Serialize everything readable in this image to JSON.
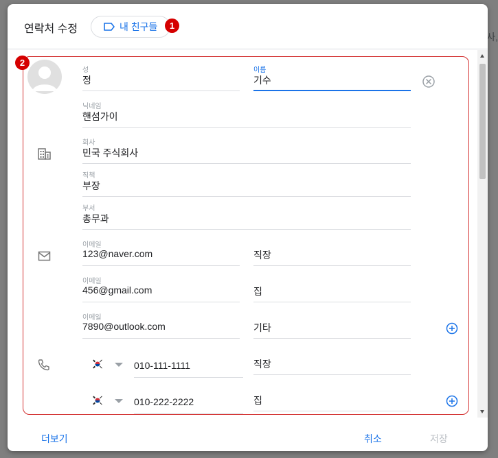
{
  "background": {
    "fragment_text": "사,"
  },
  "header": {
    "title": "연락처 수정",
    "label_chip": "내 친구들",
    "badge_1": "1"
  },
  "body": {
    "badge_2": "2",
    "name": {
      "last_label": "성",
      "last_value": "정",
      "first_label": "이름",
      "first_value": "기수"
    },
    "nickname": {
      "label": "닉네임",
      "value": "핸섬가이"
    },
    "company": {
      "label": "회사",
      "value": "민국 주식회사"
    },
    "job_title": {
      "label": "직책",
      "value": "부장"
    },
    "department": {
      "label": "부서",
      "value": "총무과"
    },
    "emails": [
      {
        "label": "이메일",
        "value": "123@naver.com",
        "type": "직장"
      },
      {
        "label": "이메일",
        "value": "456@gmail.com",
        "type": "집"
      },
      {
        "label": "이메일",
        "value": "7890@outlook.com",
        "type": "기타"
      }
    ],
    "phones": [
      {
        "number": "010-111-1111",
        "type": "직장"
      },
      {
        "number": "010-222-2222",
        "type": "집"
      }
    ]
  },
  "footer": {
    "more": "더보기",
    "cancel": "취소",
    "save": "저장"
  },
  "colors": {
    "accent": "#1a73e8",
    "highlight": "#d32f2f",
    "badge": "#d50000"
  },
  "icons": [
    "label-icon",
    "avatar-icon",
    "clear-icon",
    "business-icon",
    "email-icon",
    "phone-icon",
    "korea-flag-icon",
    "add-circle-icon"
  ]
}
